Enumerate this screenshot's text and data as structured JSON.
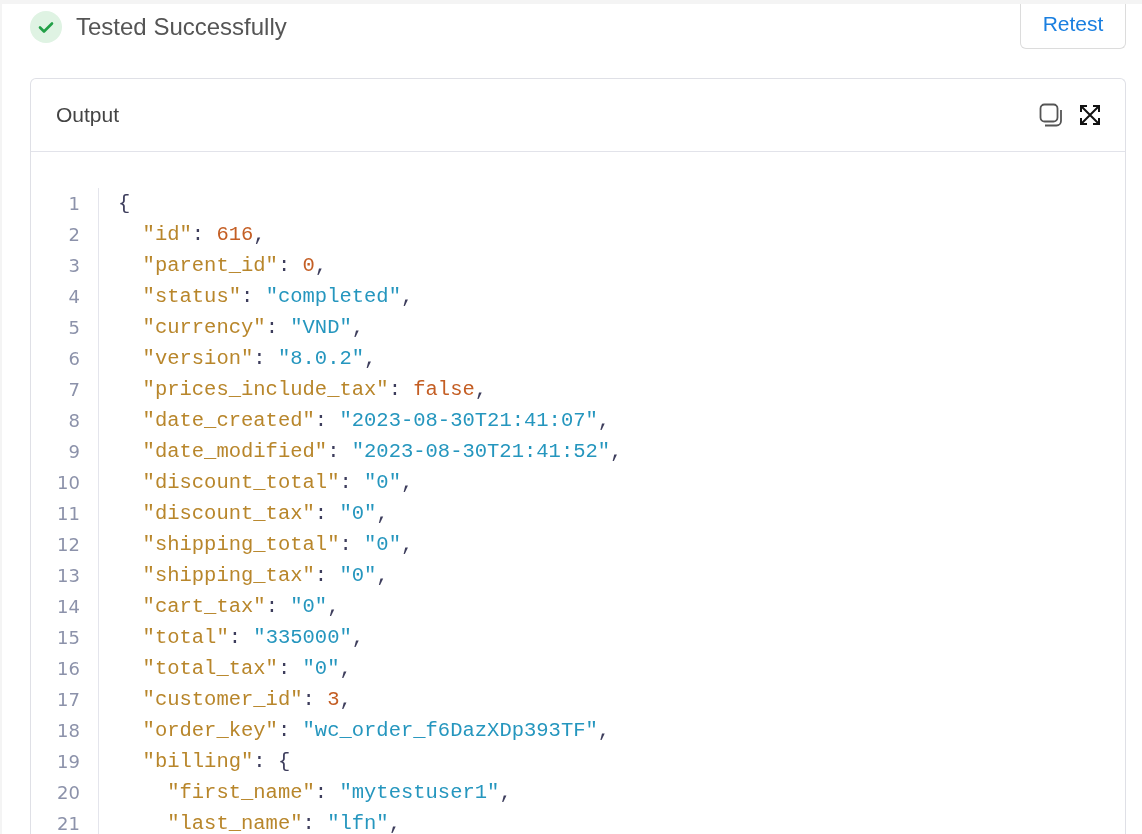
{
  "test_status": {
    "success": true,
    "label": "Tested Successfully"
  },
  "retest_button": {
    "label": "Retest"
  },
  "output": {
    "title": "Output",
    "lines": [
      {
        "number": "1",
        "tokens": [
          {
            "kind": "punct",
            "text": "{"
          }
        ]
      },
      {
        "number": "2",
        "tokens": [
          {
            "kind": "key",
            "text": "  \"id\""
          },
          {
            "kind": "punct",
            "text": ": "
          },
          {
            "kind": "number",
            "text": "616"
          },
          {
            "kind": "punct",
            "text": ","
          }
        ]
      },
      {
        "number": "3",
        "tokens": [
          {
            "kind": "key",
            "text": "  \"parent_id\""
          },
          {
            "kind": "punct",
            "text": ": "
          },
          {
            "kind": "number",
            "text": "0"
          },
          {
            "kind": "punct",
            "text": ","
          }
        ]
      },
      {
        "number": "4",
        "tokens": [
          {
            "kind": "key",
            "text": "  \"status\""
          },
          {
            "kind": "punct",
            "text": ": "
          },
          {
            "kind": "string",
            "text": "\"completed\""
          },
          {
            "kind": "punct",
            "text": ","
          }
        ]
      },
      {
        "number": "5",
        "tokens": [
          {
            "kind": "key",
            "text": "  \"currency\""
          },
          {
            "kind": "punct",
            "text": ": "
          },
          {
            "kind": "string",
            "text": "\"VND\""
          },
          {
            "kind": "punct",
            "text": ","
          }
        ]
      },
      {
        "number": "6",
        "tokens": [
          {
            "kind": "key",
            "text": "  \"version\""
          },
          {
            "kind": "punct",
            "text": ": "
          },
          {
            "kind": "string",
            "text": "\"8.0.2\""
          },
          {
            "kind": "punct",
            "text": ","
          }
        ]
      },
      {
        "number": "7",
        "tokens": [
          {
            "kind": "key",
            "text": "  \"prices_include_tax\""
          },
          {
            "kind": "punct",
            "text": ": "
          },
          {
            "kind": "boolean",
            "text": "false"
          },
          {
            "kind": "punct",
            "text": ","
          }
        ]
      },
      {
        "number": "8",
        "tokens": [
          {
            "kind": "key",
            "text": "  \"date_created\""
          },
          {
            "kind": "punct",
            "text": ": "
          },
          {
            "kind": "string",
            "text": "\"2023-08-30T21:41:07\""
          },
          {
            "kind": "punct",
            "text": ","
          }
        ]
      },
      {
        "number": "9",
        "tokens": [
          {
            "kind": "key",
            "text": "  \"date_modified\""
          },
          {
            "kind": "punct",
            "text": ": "
          },
          {
            "kind": "string",
            "text": "\"2023-08-30T21:41:52\""
          },
          {
            "kind": "punct",
            "text": ","
          }
        ]
      },
      {
        "number": "10",
        "tokens": [
          {
            "kind": "key",
            "text": "  \"discount_total\""
          },
          {
            "kind": "punct",
            "text": ": "
          },
          {
            "kind": "string",
            "text": "\"0\""
          },
          {
            "kind": "punct",
            "text": ","
          }
        ]
      },
      {
        "number": "11",
        "tokens": [
          {
            "kind": "key",
            "text": "  \"discount_tax\""
          },
          {
            "kind": "punct",
            "text": ": "
          },
          {
            "kind": "string",
            "text": "\"0\""
          },
          {
            "kind": "punct",
            "text": ","
          }
        ]
      },
      {
        "number": "12",
        "tokens": [
          {
            "kind": "key",
            "text": "  \"shipping_total\""
          },
          {
            "kind": "punct",
            "text": ": "
          },
          {
            "kind": "string",
            "text": "\"0\""
          },
          {
            "kind": "punct",
            "text": ","
          }
        ]
      },
      {
        "number": "13",
        "tokens": [
          {
            "kind": "key",
            "text": "  \"shipping_tax\""
          },
          {
            "kind": "punct",
            "text": ": "
          },
          {
            "kind": "string",
            "text": "\"0\""
          },
          {
            "kind": "punct",
            "text": ","
          }
        ]
      },
      {
        "number": "14",
        "tokens": [
          {
            "kind": "key",
            "text": "  \"cart_tax\""
          },
          {
            "kind": "punct",
            "text": ": "
          },
          {
            "kind": "string",
            "text": "\"0\""
          },
          {
            "kind": "punct",
            "text": ","
          }
        ]
      },
      {
        "number": "15",
        "tokens": [
          {
            "kind": "key",
            "text": "  \"total\""
          },
          {
            "kind": "punct",
            "text": ": "
          },
          {
            "kind": "string",
            "text": "\"335000\""
          },
          {
            "kind": "punct",
            "text": ","
          }
        ]
      },
      {
        "number": "16",
        "tokens": [
          {
            "kind": "key",
            "text": "  \"total_tax\""
          },
          {
            "kind": "punct",
            "text": ": "
          },
          {
            "kind": "string",
            "text": "\"0\""
          },
          {
            "kind": "punct",
            "text": ","
          }
        ]
      },
      {
        "number": "17",
        "tokens": [
          {
            "kind": "key",
            "text": "  \"customer_id\""
          },
          {
            "kind": "punct",
            "text": ": "
          },
          {
            "kind": "number",
            "text": "3"
          },
          {
            "kind": "punct",
            "text": ","
          }
        ]
      },
      {
        "number": "18",
        "tokens": [
          {
            "kind": "key",
            "text": "  \"order_key\""
          },
          {
            "kind": "punct",
            "text": ": "
          },
          {
            "kind": "string",
            "text": "\"wc_order_f6DazXDp393TF\""
          },
          {
            "kind": "punct",
            "text": ","
          }
        ]
      },
      {
        "number": "19",
        "tokens": [
          {
            "kind": "key",
            "text": "  \"billing\""
          },
          {
            "kind": "punct",
            "text": ": {"
          }
        ]
      },
      {
        "number": "20",
        "tokens": [
          {
            "kind": "key",
            "text": "    \"first_name\""
          },
          {
            "kind": "punct",
            "text": ": "
          },
          {
            "kind": "string",
            "text": "\"mytestuser1\""
          },
          {
            "kind": "punct",
            "text": ","
          }
        ]
      },
      {
        "number": "21",
        "tokens": [
          {
            "kind": "key",
            "text": "    \"last_name\""
          },
          {
            "kind": "punct",
            "text": ": "
          },
          {
            "kind": "string",
            "text": "\"lfn\""
          },
          {
            "kind": "punct",
            "text": ","
          }
        ]
      }
    ]
  }
}
